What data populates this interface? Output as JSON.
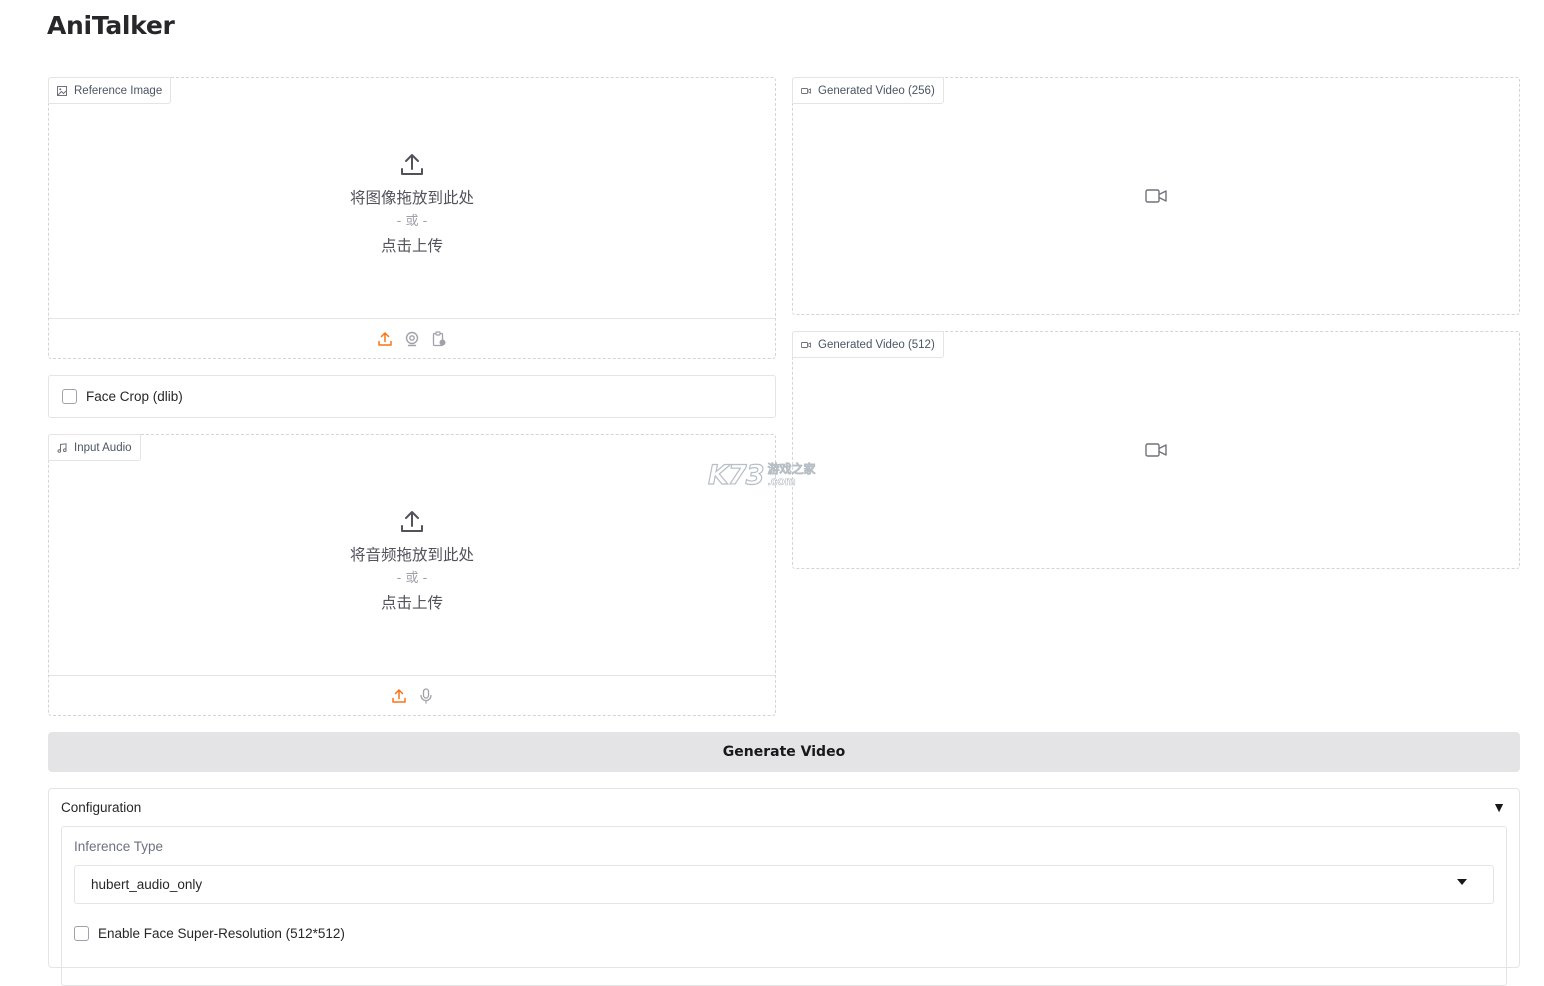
{
  "app": {
    "title": "AniTalker"
  },
  "reference_image": {
    "label": "Reference Image",
    "drop_text": "将图像拖放到此处",
    "or_text": "- 或 -",
    "click_text": "点击上传",
    "toolbar_icons": [
      "upload-icon",
      "webcam-icon",
      "clipboard-icon"
    ]
  },
  "face_crop": {
    "label": "Face Crop (dlib)",
    "checked": false
  },
  "input_audio": {
    "label": "Input Audio",
    "drop_text": "将音频拖放到此处",
    "or_text": "- 或 -",
    "click_text": "点击上传",
    "toolbar_icons": [
      "upload-icon",
      "microphone-icon"
    ]
  },
  "generated_video_256": {
    "label": "Generated Video (256)"
  },
  "generated_video_512": {
    "label": "Generated Video (512)"
  },
  "generate_button": {
    "label": "Generate Video"
  },
  "configuration": {
    "title": "Configuration",
    "caret": "▼",
    "inference_type": {
      "label": "Inference Type",
      "value": "hubert_audio_only"
    },
    "super_resolution": {
      "label": "Enable Face Super-Resolution (512*512)",
      "checked": false
    }
  },
  "watermark": {
    "main": "K73",
    "cn": "游戏之家",
    "com": ".com"
  },
  "colors": {
    "accent_orange": "#f97316",
    "button_bg": "#e4e4e7",
    "border": "#e4e4e7"
  }
}
